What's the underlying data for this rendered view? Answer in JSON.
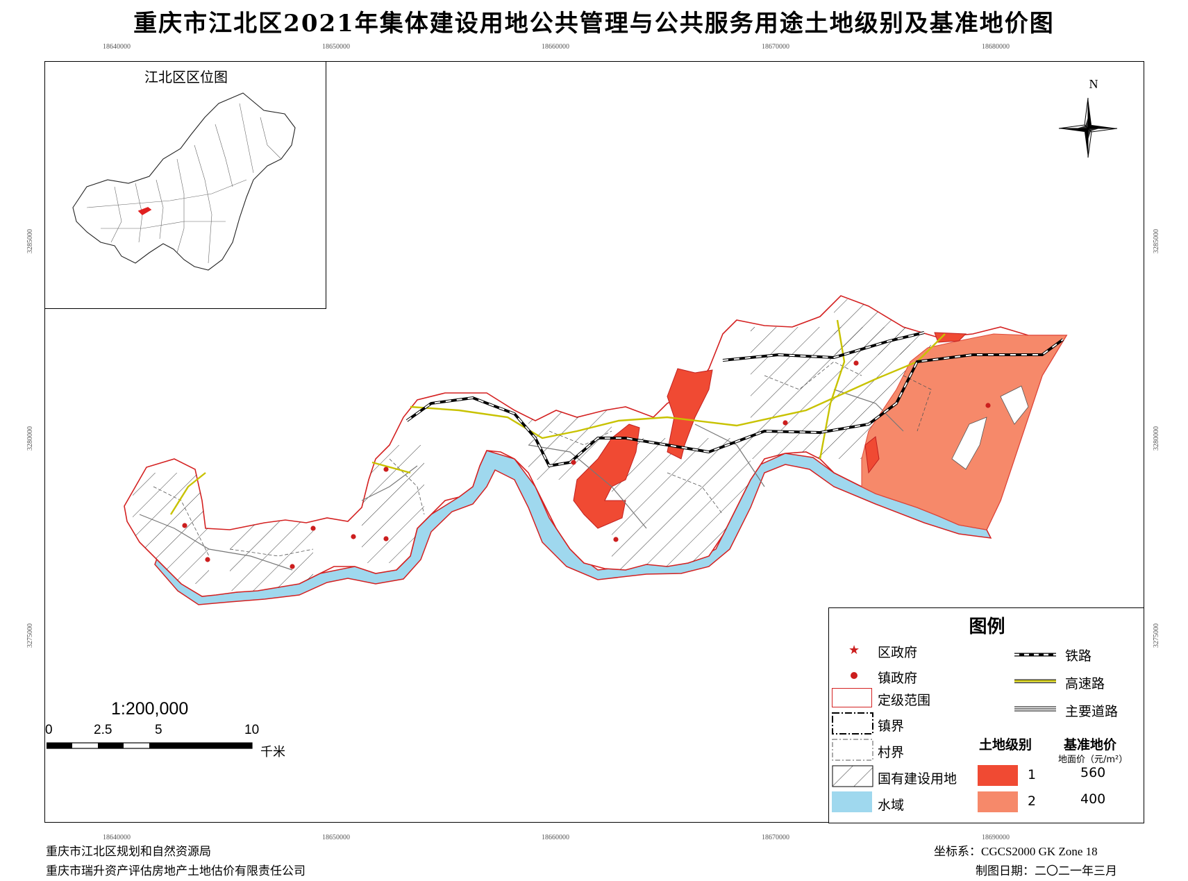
{
  "title": "重庆市江北区2021年集体建设用地公共管理与公共服务用途土地级别及基准地价图",
  "coords": {
    "top": [
      "18640000",
      "18650000",
      "18660000",
      "18670000",
      "18680000"
    ],
    "bottom": [
      "18640000",
      "18650000",
      "18660000",
      "18670000",
      "18690000"
    ],
    "left": [
      "3285000",
      "3280000",
      "3275000"
    ],
    "right": [
      "3285000",
      "3280000",
      "3275000"
    ]
  },
  "inset": {
    "title": "江北区区位图"
  },
  "north_label": "N",
  "legend": {
    "title": "图例",
    "items": [
      {
        "label": "区政府",
        "symbol": "star"
      },
      {
        "label": "镇政府",
        "symbol": "dot"
      },
      {
        "label": "定级范围",
        "symbol": "red-box"
      },
      {
        "label": "镇界",
        "symbol": "town-border"
      },
      {
        "label": "村界",
        "symbol": "village-border"
      },
      {
        "label": "国有建设用地",
        "symbol": "hatch"
      },
      {
        "label": "水域",
        "symbol": "water"
      }
    ],
    "lines": [
      {
        "label": "铁路",
        "symbol": "railway"
      },
      {
        "label": "高速路",
        "symbol": "highway"
      },
      {
        "label": "主要道路",
        "symbol": "main-road"
      }
    ],
    "grade_header": "土地级别",
    "price_header": "基准地价",
    "price_unit": "地面价（元/m²）",
    "grades": [
      {
        "grade": "1",
        "price": "560",
        "color": "#f04a33"
      },
      {
        "grade": "2",
        "price": "400",
        "color": "#f6896a"
      }
    ]
  },
  "colors": {
    "water": "#9fd8ee",
    "boundary": "#d42020",
    "grade1": "#f04a33",
    "grade2": "#f6896a",
    "highway": "#c8c200"
  },
  "scale": {
    "ratio": "1:200,000",
    "ticks": [
      "0",
      "2.5",
      "5",
      "10"
    ],
    "unit": "千米"
  },
  "footer": {
    "org1": "重庆市江北区规划和自然资源局",
    "org2": "重庆市瑞升资产评估房地产土地估价有限责任公司",
    "crs": "坐标系：CGCS2000  GK  Zone  18",
    "date": "制图日期：二〇二一年三月"
  }
}
